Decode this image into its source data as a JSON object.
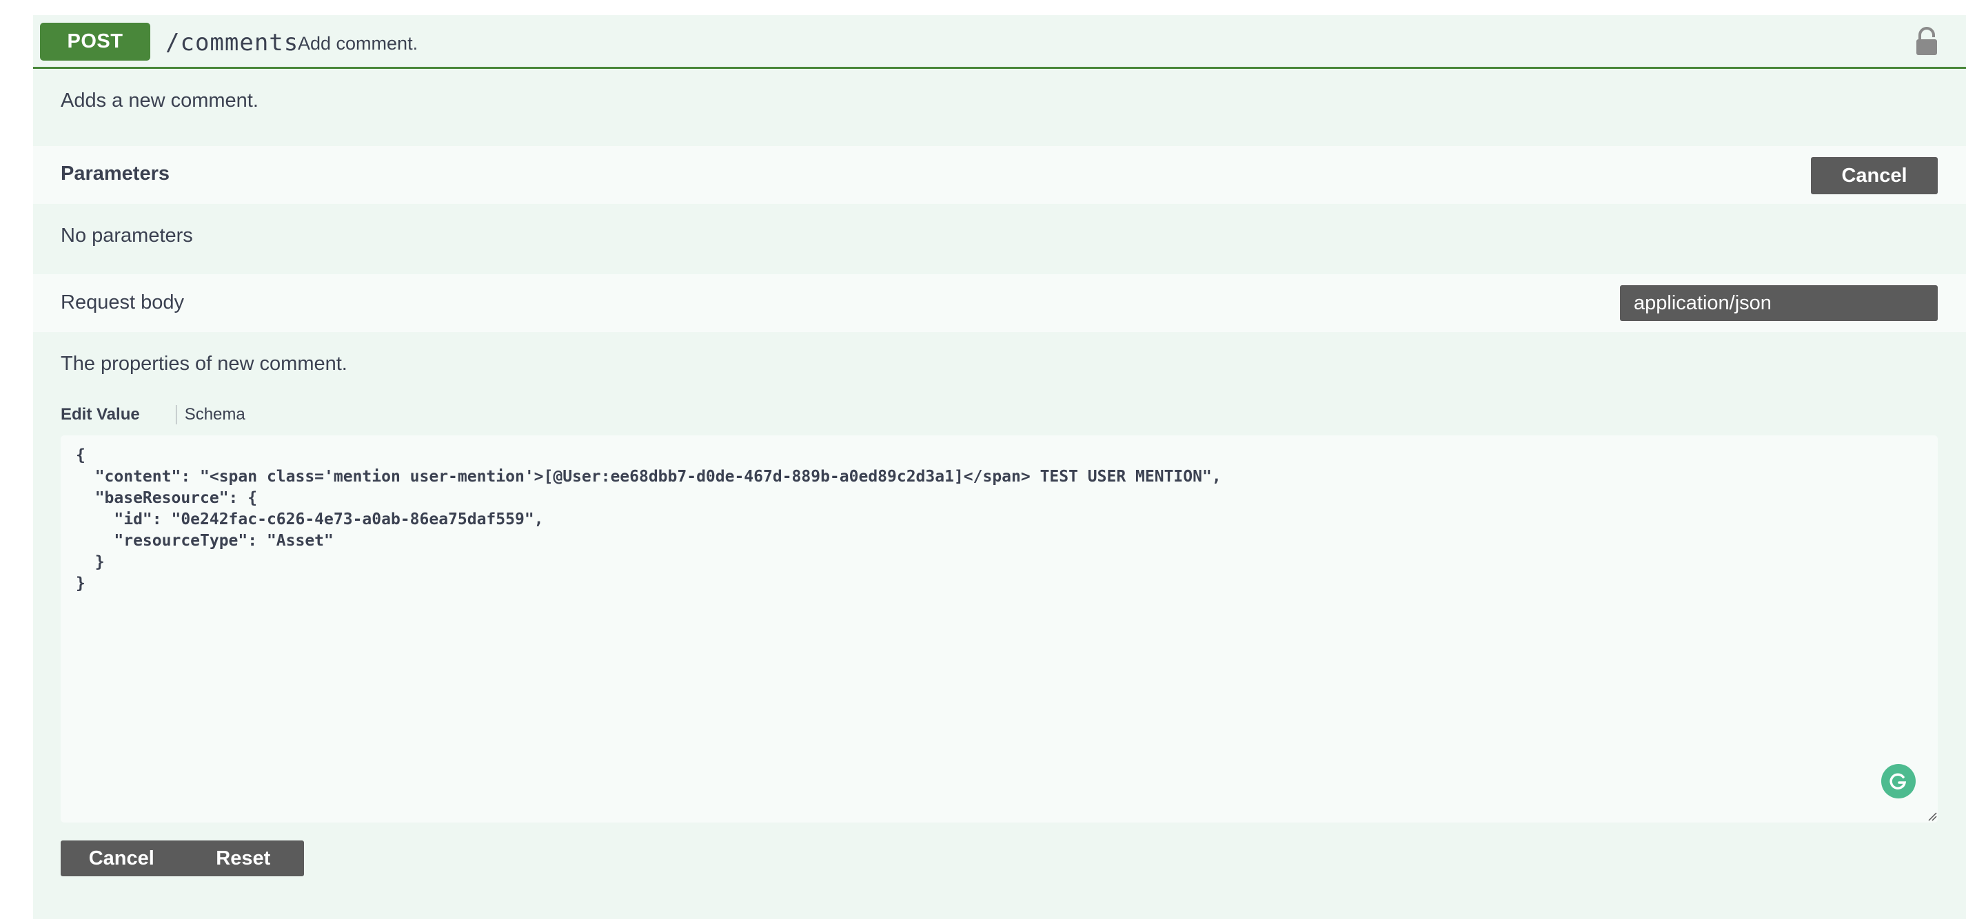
{
  "operation": {
    "method": "POST",
    "path": "/comments",
    "summary": "Add comment.",
    "description": "Adds a new comment.",
    "method_color": "#49873a"
  },
  "parameters": {
    "title": "Parameters",
    "cancel_label": "Cancel",
    "empty_text": "No parameters"
  },
  "request_body": {
    "title": "Request body",
    "content_type": "application/json",
    "description": "The properties of new comment.",
    "tabs": {
      "edit_value": "Edit Value",
      "schema": "Schema"
    },
    "value": "{\n  \"content\": \"<span class='mention user-mention'>[@User:ee68dbb7-d0de-467d-889b-a0ed89c2d3a1]</span> TEST USER MENTION\",\n  \"baseResource\": {\n    \"id\": \"0e242fac-c626-4e73-a0ab-86ea75daf559\",\n    \"resourceType\": \"Asset\"\n  }\n}"
  },
  "actions": {
    "cancel_label": "Cancel",
    "reset_label": "Reset"
  },
  "icons": {
    "lock": "lock-icon",
    "grammarly": "grammarly-icon",
    "resize": "resize-handle-icon"
  }
}
